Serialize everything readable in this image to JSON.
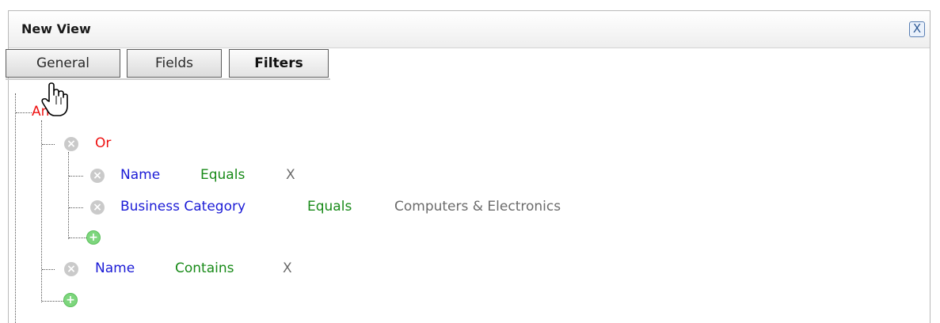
{
  "dialog": {
    "title": "New View",
    "close_label": "X"
  },
  "tabs": [
    {
      "label": "General"
    },
    {
      "label": "Fields"
    },
    {
      "label": "Filters"
    }
  ],
  "filters": {
    "root": "And",
    "group": "Or",
    "conditions": [
      {
        "field": "Name",
        "operator": "Equals",
        "value": "X"
      },
      {
        "field": "Business Category",
        "operator": "Equals",
        "value": "Computers & Electronics"
      },
      {
        "field": "Name",
        "operator": "Contains",
        "value": "X"
      }
    ]
  },
  "icons": {
    "remove": "remove-condition-icon",
    "add": "add-condition-icon",
    "cursor": "hand-pointer-icon"
  }
}
